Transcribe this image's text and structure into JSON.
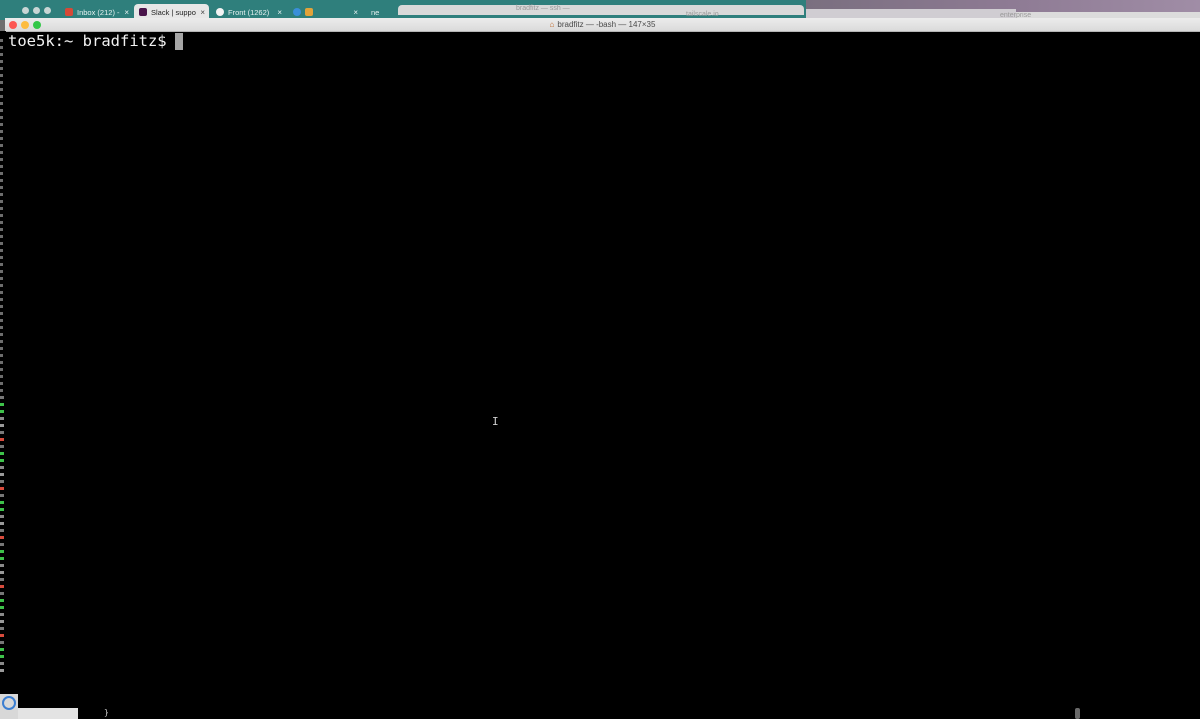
{
  "browser": {
    "tabs": [
      {
        "label": "Inbox (212) -",
        "favicon_color": "#d64937",
        "active": false
      },
      {
        "label": "Slack | suppo",
        "favicon_color": "#4a154b",
        "active": true
      },
      {
        "label": "Front (1262)",
        "favicon_color": "#111111",
        "active": false
      },
      {
        "label": "",
        "favicon_color": "#3a8fd9",
        "active": false
      }
    ],
    "close_glyph": "×",
    "partial_tab_label": "ne",
    "strip_color": "#2f7f7c"
  },
  "background_windows": {
    "title_a": "bradfitz — ssh —",
    "title_b": "tailscale.io",
    "title_c": "enterprise"
  },
  "terminal": {
    "title": "bradfitz — -bash — 147×35",
    "prompt": "toe5k:~ bradfitz$",
    "background": "#000000",
    "text_color": "#f2f2f2"
  },
  "misc": {
    "ibeam_glyph": "I",
    "brace_glyph": "}"
  }
}
